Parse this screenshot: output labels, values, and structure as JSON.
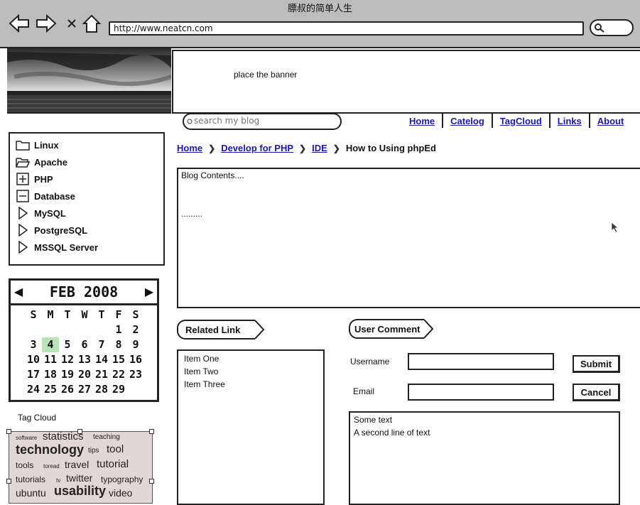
{
  "window": {
    "title": "膘叔的简单人生"
  },
  "browser": {
    "url": "http://www.neatcn.com"
  },
  "banner": {
    "text": "place the banner"
  },
  "search": {
    "placeholder": "search my blog"
  },
  "nav": [
    {
      "label": "Home"
    },
    {
      "label": "Catelog"
    },
    {
      "label": "TagCloud"
    },
    {
      "label": "Links"
    },
    {
      "label": "About"
    }
  ],
  "breadcrumb": {
    "links": [
      {
        "label": "Home"
      },
      {
        "label": "Develop for PHP"
      },
      {
        "label": "IDE"
      }
    ],
    "current": "How to Using phpEd"
  },
  "tree": [
    {
      "label": "Linux",
      "icon": "folder-icon"
    },
    {
      "label": "Apache",
      "icon": "folder-open-icon"
    },
    {
      "label": "PHP",
      "icon": "plus-box-icon"
    },
    {
      "label": "Database",
      "icon": "minus-box-icon"
    },
    {
      "label": "MySQL",
      "icon": "triangle-right-icon"
    },
    {
      "label": "PostgreSQL",
      "icon": "triangle-right-icon"
    },
    {
      "label": "MSSQL Server",
      "icon": "triangle-right-icon"
    }
  ],
  "calendar": {
    "month": "FEB 2008",
    "weekdays": [
      "S",
      "M",
      "T",
      "W",
      "T",
      "F",
      "S"
    ],
    "today": "4",
    "cells": [
      "",
      "",
      "",
      "",
      "",
      "1",
      "2",
      "3",
      "4",
      "5",
      "6",
      "7",
      "8",
      "9",
      "10",
      "11",
      "12",
      "13",
      "14",
      "15",
      "16",
      "17",
      "18",
      "19",
      "20",
      "21",
      "22",
      "23",
      "24",
      "25",
      "26",
      "27",
      "28",
      "29",
      ""
    ]
  },
  "tag_cloud": {
    "label": "Tag Cloud",
    "tags": [
      {
        "text": "software"
      },
      {
        "text": "statistics"
      },
      {
        "text": "teaching"
      },
      {
        "text": "technology"
      },
      {
        "text": "tips"
      },
      {
        "text": "tool"
      },
      {
        "text": "tools"
      },
      {
        "text": "toread"
      },
      {
        "text": "travel"
      },
      {
        "text": "tutorial"
      },
      {
        "text": "tutorials"
      },
      {
        "text": "tv"
      },
      {
        "text": "twitter"
      },
      {
        "text": "typography"
      },
      {
        "text": "ubuntu"
      },
      {
        "text": "usability"
      },
      {
        "text": "video"
      }
    ]
  },
  "content": {
    "line1": "Blog Contents....",
    "line2": "........."
  },
  "related": {
    "title": "Related Link",
    "items": [
      "Item One",
      "Item Two",
      "Item Three"
    ]
  },
  "comment": {
    "title": "User Comment",
    "username_label": "Username",
    "email_label": "Email",
    "username_value": "",
    "email_value": "",
    "submit_label": "Submit",
    "cancel_label": "Cancel",
    "text_lines": [
      "Some text",
      "A second line of text"
    ]
  },
  "colors": {
    "link": "#1a1aa6",
    "today": "#b8e4b8",
    "tagcloud_bg": "#e3d6d6",
    "chrome": "#bdbdbd"
  }
}
